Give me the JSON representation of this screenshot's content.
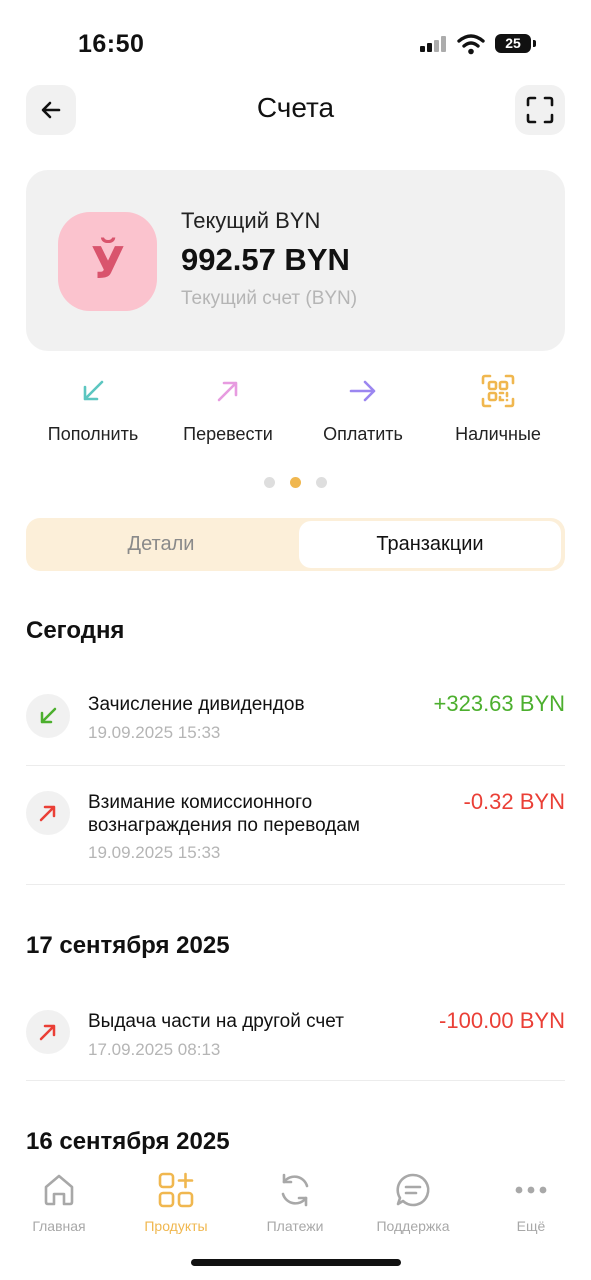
{
  "status_bar": {
    "time": "16:50",
    "battery": "25"
  },
  "header": {
    "title": "Счета"
  },
  "account": {
    "logo_glyph": "Ў",
    "name": "Текущий BYN",
    "balance": "992.57 BYN",
    "type": "Текущий счет (BYN)"
  },
  "actions": [
    {
      "label": "Пополнить",
      "icon": "arrow-down-left-icon",
      "color": "#5cc6c0"
    },
    {
      "label": "Перевести",
      "icon": "arrow-up-right-icon",
      "color": "#e79be0"
    },
    {
      "label": "Оплатить",
      "icon": "arrow-right-icon",
      "color": "#9b86f0"
    },
    {
      "label": "Наличные",
      "icon": "qr-code-icon",
      "color": "#f0b74f"
    }
  ],
  "tabs": {
    "details": "Детали",
    "transactions": "Транзакции"
  },
  "sections": [
    {
      "title": "Сегодня",
      "transactions": [
        {
          "title": "Зачисление дивидендов",
          "date": "19.09.2025 15:33",
          "amount": "+323.63 BYN",
          "direction": "in"
        },
        {
          "title": "Взимание комиссионного вознаграждения по переводам",
          "date": "19.09.2025 15:33",
          "amount": "-0.32 BYN",
          "direction": "out"
        }
      ]
    },
    {
      "title": "17 сентября 2025",
      "transactions": [
        {
          "title": "Выдача части на другой счет",
          "date": "17.09.2025 08:13",
          "amount": "-100.00 BYN",
          "direction": "out"
        }
      ]
    },
    {
      "title": "16 сентября 2025",
      "transactions": []
    }
  ],
  "bottom_nav": [
    {
      "label": "Главная",
      "icon": "home-icon",
      "active": false
    },
    {
      "label": "Продукты",
      "icon": "products-grid-icon",
      "active": true
    },
    {
      "label": "Платежи",
      "icon": "refresh-icon",
      "active": false
    },
    {
      "label": "Поддержка",
      "icon": "chat-icon",
      "active": false
    },
    {
      "label": "Ещё",
      "icon": "more-icon",
      "active": false
    }
  ],
  "colors": {
    "accent": "#f0b74f",
    "positive": "#4caf2e",
    "negative": "#ea3f36",
    "card_bg": "#f1f1f1",
    "logo_bg": "#fbc3ce",
    "logo_fg": "#d9546d"
  }
}
